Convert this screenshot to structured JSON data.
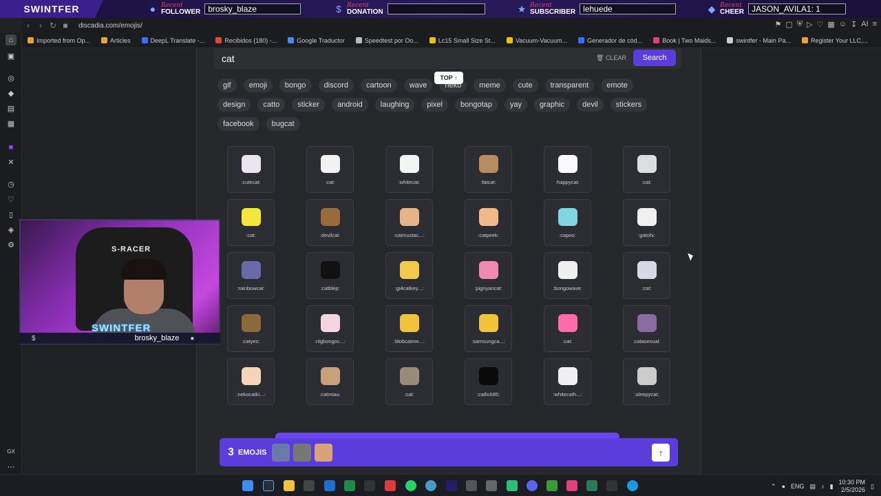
{
  "overlay": {
    "brand": "SWINTFER",
    "recent_label": "Recent",
    "follower_label": "FOLLOWER",
    "follower_value": "brosky_blaze",
    "donation_label": "DONATION",
    "donation_value": "",
    "subscriber_label": "SUBSCRIBER",
    "subscriber_value": "lehuede",
    "cheer_label": "CHEER",
    "cheer_value": "JASON_AVILA1: 1"
  },
  "browser": {
    "url": "discadia.com/emojis/",
    "ai_label": "AI",
    "bookmarks": [
      {
        "label": "Imported from Op...",
        "color": "#e8a23a"
      },
      {
        "label": "Articles",
        "color": "#e8a23a"
      },
      {
        "label": "DeepL Translate -...",
        "color": "#3b6cff"
      },
      {
        "label": "Recibidos (180) -...",
        "color": "#e04a3a"
      },
      {
        "label": "Google Traductor",
        "color": "#4a8af4"
      },
      {
        "label": "Speedtest por Oo...",
        "color": "#bbbbbb"
      },
      {
        "label": "Lc15 Small Size St...",
        "color": "#f2c200"
      },
      {
        "label": "Vacuum-Vacuum...",
        "color": "#f2c200"
      },
      {
        "label": "Generador de cód...",
        "color": "#3b6cff"
      },
      {
        "label": "Book | Two Maids...",
        "color": "#e0407a"
      },
      {
        "label": "swintfer - Main Pa...",
        "color": "#cccccc"
      },
      {
        "label": "Register Your LLC,...",
        "color": "#e8a23a"
      }
    ]
  },
  "search": {
    "query": "cat",
    "clear_label": "CLEAR",
    "button_label": "Search",
    "top_label": "TOP ↑"
  },
  "tags": [
    "gif",
    "emoji",
    "bongo",
    "discord",
    "cartoon",
    "wave",
    "neko",
    "meme",
    "cute",
    "transparent",
    "emote",
    "design",
    "catto",
    "sticker",
    "android",
    "laughing",
    "pixel",
    "bongotap",
    "yay",
    "graphic",
    "devil",
    "stickers",
    "facebook",
    "bugcat"
  ],
  "emojis": [
    {
      "name": ":cutecat:",
      "color": "#e9e4ef"
    },
    {
      "name": ":cat:",
      "color": "#f2f2f2"
    },
    {
      "name": ":whitecat:",
      "color": "#f4f4f4"
    },
    {
      "name": ":fatcat:",
      "color": "#b98b62"
    },
    {
      "name": ":happycat:",
      "color": "#fafafa"
    },
    {
      "name": ":cat:",
      "color": "#dddddd"
    },
    {
      "name": ":cat:",
      "color": "#f5e63a"
    },
    {
      "name": ":devilcat:",
      "color": "#9b6a3a"
    },
    {
      "name": ":catmustac...:",
      "color": "#e7b48a"
    },
    {
      "name": ":catpeek:",
      "color": "#f0b98a"
    },
    {
      "name": ":capoo:",
      "color": "#7fd4e0"
    },
    {
      "name": ":gatohi:",
      "color": "#f0f0f0"
    },
    {
      "name": ":rainbowcat:",
      "color": "#6a6aaa"
    },
    {
      "name": ":catblep:",
      "color": "#111111"
    },
    {
      "name": ":gi4catkey...:",
      "color": "#f2c94a"
    },
    {
      "name": ":pignyancat:",
      "color": "#f08ab0"
    },
    {
      "name": ":bongowave:",
      "color": "#f0f0f0"
    },
    {
      "name": ":cat:",
      "color": "#d8d8e8"
    },
    {
      "name": ":catyes:",
      "color": "#8a6a3a"
    },
    {
      "name": ":nlgbongoc...:",
      "color": "#f5d5e0"
    },
    {
      "name": ":blobcatme...:",
      "color": "#f2c23a"
    },
    {
      "name": ":samsungca...:",
      "color": "#f2c23a"
    },
    {
      "name": ":cat:",
      "color": "#ff6aa8"
    },
    {
      "name": ":catasexual:",
      "color": "#8a6aa0"
    },
    {
      "name": ":nekocatki...:",
      "color": "#f5d5b5"
    },
    {
      "name": ":catmiau:",
      "color": "#c8a07a"
    },
    {
      "name": ":cat:",
      "color": "#9a8a7a"
    },
    {
      "name": ":catlick85:",
      "color": "#0a0a0a"
    },
    {
      "name": ":whitecath...:",
      "color": "#f0f0f0"
    },
    {
      "name": ":sleepycat:",
      "color": "#cccccc"
    }
  ],
  "tray": {
    "count": "3",
    "label": "EMOJIS",
    "thumbs": [
      "#6a7aa8",
      "#777777",
      "#d8a27a"
    ],
    "up_icon": "↑"
  },
  "webcam": {
    "chair_text": "S-RACER",
    "name_overlay": "SWINTFER",
    "username": "brosky_blaze"
  },
  "taskbar": {
    "lang": "ENG",
    "time": "10:30 PM",
    "date": "2/5/2026"
  }
}
